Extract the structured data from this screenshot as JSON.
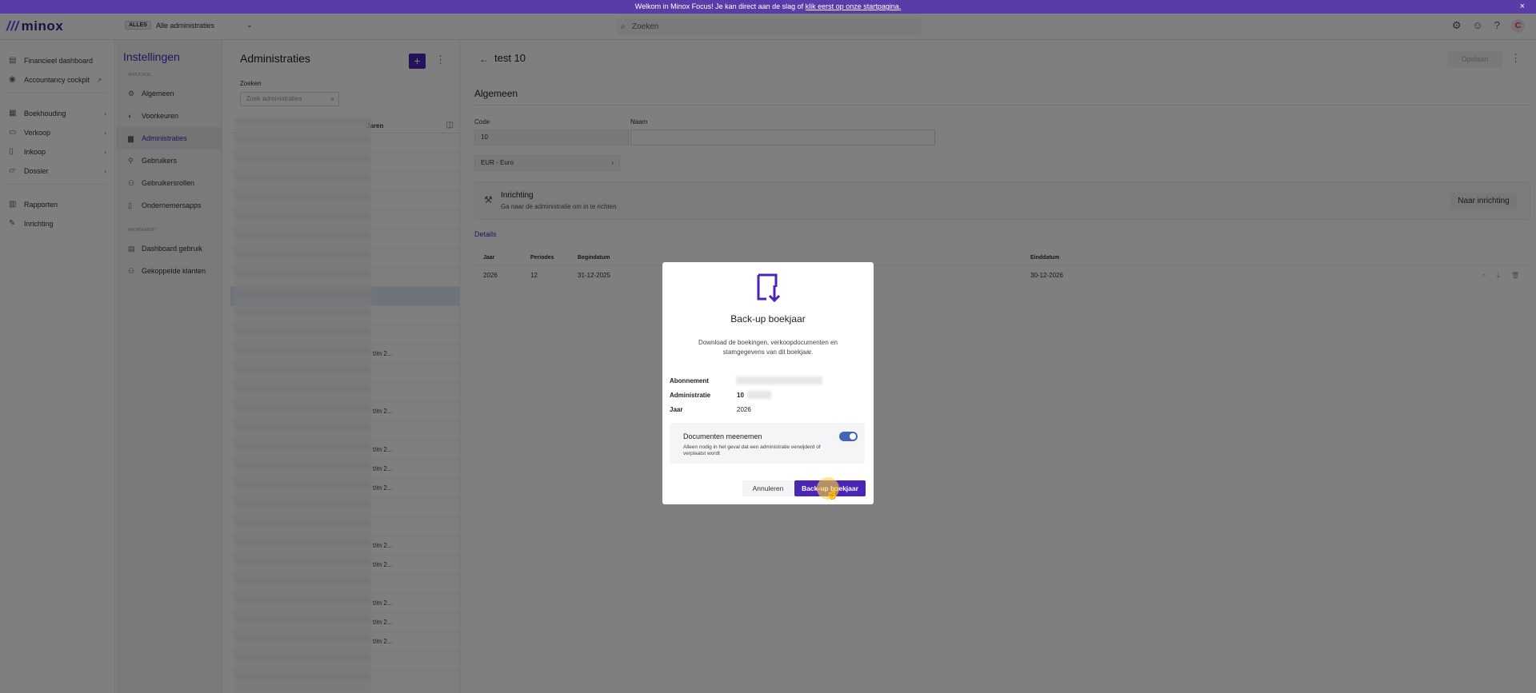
{
  "banner": {
    "text": "Welkom in Minox Focus! Je kan direct aan de slag of ",
    "link": "klik eerst op onze startpagina.",
    "close": "×"
  },
  "header": {
    "logo": "minox",
    "logo_mark": "///",
    "scope_pill": "ALLES",
    "scope_label": "Alle administraties",
    "search_placeholder": "Zoeken",
    "avatar": "C"
  },
  "sidebar": {
    "items": [
      {
        "label": "Financieel dashboard",
        "icon": "bar-chart-icon"
      },
      {
        "label": "Accountancy cockpit",
        "icon": "cockpit-icon"
      },
      {
        "label": "Boekhouding",
        "icon": "book-icon"
      },
      {
        "label": "Verkoop",
        "icon": "cart-icon"
      },
      {
        "label": "Inkoop",
        "icon": "receipt-icon"
      },
      {
        "label": "Dossier",
        "icon": "folder-icon"
      },
      {
        "label": "Rapporten",
        "icon": "report-icon"
      },
      {
        "label": "Inrichting",
        "icon": "wrench-icon"
      }
    ]
  },
  "settings": {
    "title": "Instellingen",
    "section1": "APPLICATIE",
    "items1": [
      "Algemeen",
      "Voorkeuren",
      "Administraties",
      "Gebruikers",
      "Gebruikersrollen",
      "Ondernemersapps"
    ],
    "section2": "ABONNEMENT",
    "items2": [
      "Dashboard gebruik",
      "Gekoppelde klanten"
    ]
  },
  "list": {
    "title": "Administraties",
    "add": "+",
    "search_label": "Zoeken",
    "search_placeholder": "Zoek administraties",
    "col_jaren": "Jaren",
    "rows": [
      "",
      "",
      "",
      "",
      "",
      "",
      "",
      "",
      "",
      "",
      "",
      "t/m 2...",
      "",
      "",
      "t/m 2...",
      "",
      "t/m 2...",
      "t/m 2...",
      "t/m 2...",
      "",
      "",
      "t/m 2...",
      "t/m 2...",
      "",
      "t/m 2...",
      "t/m 2...",
      "t/m 2...",
      ""
    ]
  },
  "detail": {
    "title": "test 10",
    "save": "Opslaan",
    "section": "Algemeen",
    "code_label": "Code",
    "code_value": "10",
    "naam_label": "Naam",
    "currency": "EUR - Euro",
    "inrichting_title": "Inrichting",
    "inrichting_sub": "Ga naar de administratie om in te richten",
    "inrichting_btn": "Naar inrichting",
    "details_link": "Details",
    "table_headers": [
      "Jaar",
      "Periodes",
      "Begindatum",
      "Einddatum"
    ],
    "table_row": [
      "2026",
      "12",
      "31-12-2025",
      "30-12-2026"
    ]
  },
  "modal": {
    "title": "Back-up boekjaar",
    "description": "Download de boekingen, verkoopdocumenten en stamgegevens van dit boekjaar.",
    "abonnement_label": "Abonnement",
    "administratie_label": "Administratie",
    "administratie_value": "10",
    "jaar_label": "Jaar",
    "jaar_value": "2026",
    "option_title": "Documenten meenemen",
    "option_sub": "Alleen nodig in het geval dat een administratie verwijderd of verplaatst wordt",
    "option_enabled": true,
    "cancel": "Annuleren",
    "confirm": "Back-up boekjaar"
  },
  "colors": {
    "brand": "#4b25b5",
    "banner": "#5a3ba8",
    "toggle": "#4464b8"
  }
}
